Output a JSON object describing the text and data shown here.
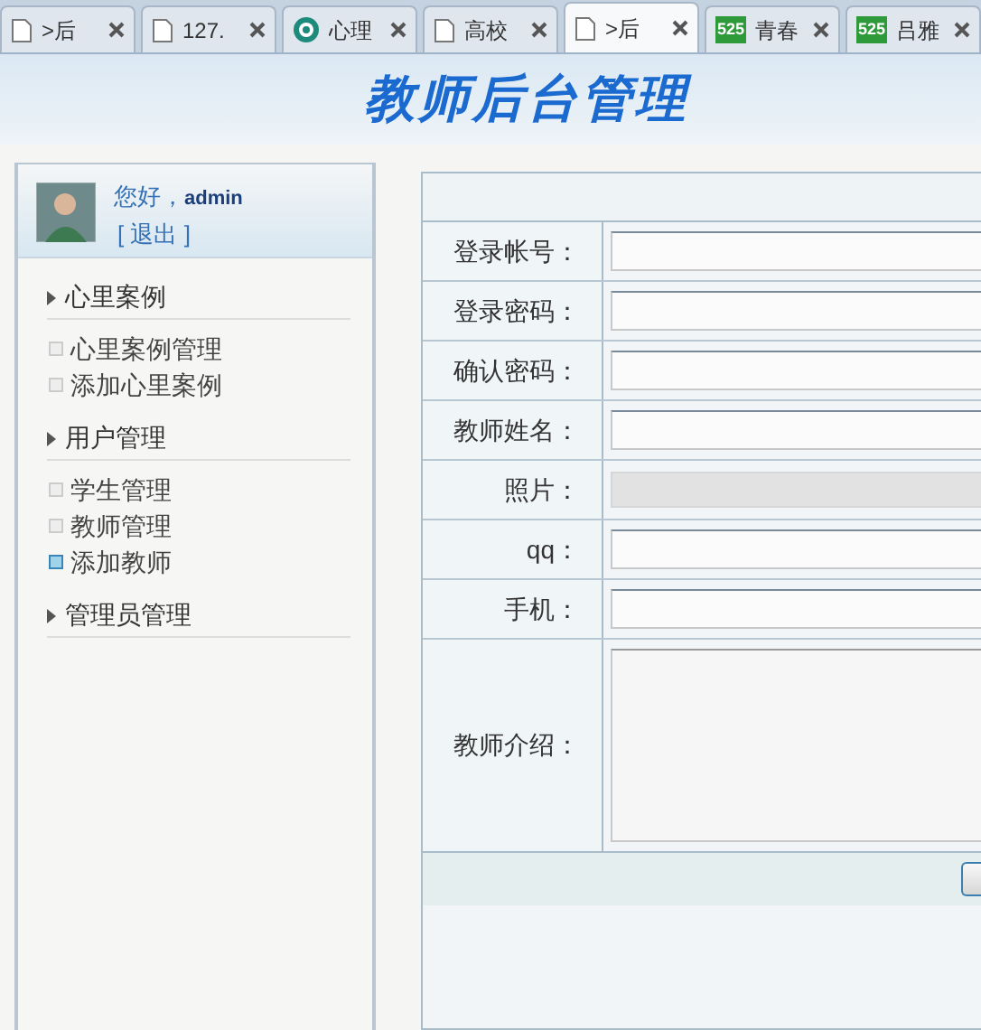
{
  "tabs": [
    {
      "label": ">后",
      "kind": "page",
      "selected": false
    },
    {
      "label": "127.",
      "kind": "page",
      "selected": false
    },
    {
      "label": "心理",
      "kind": "logo",
      "selected": false
    },
    {
      "label": "高校",
      "kind": "page",
      "selected": false
    },
    {
      "label": ">后",
      "kind": "page",
      "selected": true
    },
    {
      "label": "青春",
      "kind": "badge",
      "badge": "525",
      "selected": false
    },
    {
      "label": "吕雅",
      "kind": "badge",
      "badge": "525",
      "selected": false
    }
  ],
  "header": {
    "title": "教师后台管理"
  },
  "user": {
    "greeting": "您好，",
    "name": "admin",
    "logout": "[ 退出 ]"
  },
  "sidebar": [
    {
      "title": "心里案例",
      "items": [
        {
          "label": "心里案例管理",
          "selected": false
        },
        {
          "label": "添加心里案例",
          "selected": false
        }
      ]
    },
    {
      "title": "用户管理",
      "items": [
        {
          "label": "学生管理",
          "selected": false
        },
        {
          "label": "教师管理",
          "selected": false
        },
        {
          "label": "添加教师",
          "selected": true
        }
      ]
    },
    {
      "title": "管理员管理"
    }
  ],
  "form": {
    "fields": [
      {
        "label": "登录帐号：",
        "kind": "input",
        "disabled": false
      },
      {
        "label": "登录密码：",
        "kind": "input",
        "disabled": false
      },
      {
        "label": "确认密码：",
        "kind": "input",
        "disabled": false
      },
      {
        "label": "教师姓名：",
        "kind": "input",
        "disabled": false
      },
      {
        "label": "照片：",
        "kind": "input",
        "disabled": true
      },
      {
        "label": "qq：",
        "kind": "input",
        "disabled": false
      },
      {
        "label": "手机：",
        "kind": "input",
        "disabled": false
      },
      {
        "label": "教师介绍：",
        "kind": "textarea"
      }
    ]
  }
}
